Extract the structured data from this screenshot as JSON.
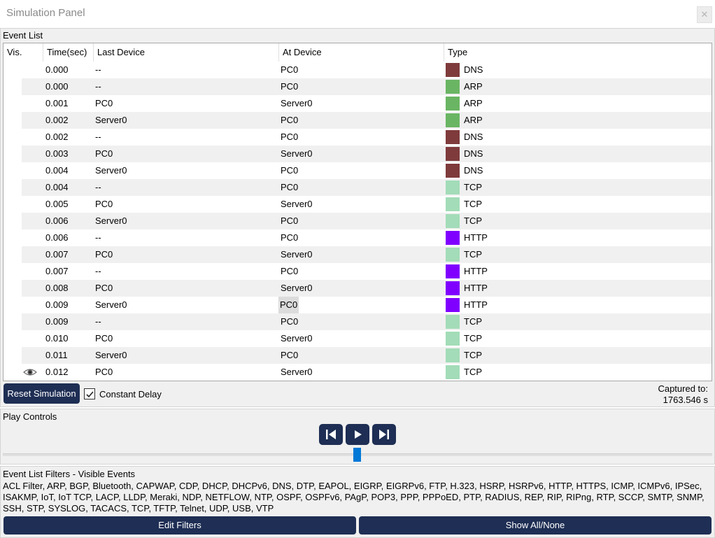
{
  "window": {
    "title": "Simulation Panel",
    "close_glyph": "✕"
  },
  "event_list": {
    "label": "Event List",
    "columns": {
      "vis": "Vis.",
      "time": "Time(sec)",
      "last_device": "Last Device",
      "at_device": "At Device",
      "type": "Type"
    },
    "type_colors": {
      "DNS": "#7f3b3b",
      "ARP": "#6ab563",
      "TCP": "#a3dcb8",
      "HTTP": "#8000ff"
    },
    "rows": [
      {
        "time": "0.000",
        "last": "--",
        "at": "PC0",
        "type": "DNS"
      },
      {
        "time": "0.000",
        "last": "--",
        "at": "PC0",
        "type": "ARP"
      },
      {
        "time": "0.001",
        "last": "PC0",
        "at": "Server0",
        "type": "ARP"
      },
      {
        "time": "0.002",
        "last": "Server0",
        "at": "PC0",
        "type": "ARP"
      },
      {
        "time": "0.002",
        "last": "--",
        "at": "PC0",
        "type": "DNS"
      },
      {
        "time": "0.003",
        "last": "PC0",
        "at": "Server0",
        "type": "DNS"
      },
      {
        "time": "0.004",
        "last": "Server0",
        "at": "PC0",
        "type": "DNS"
      },
      {
        "time": "0.004",
        "last": "--",
        "at": "PC0",
        "type": "TCP"
      },
      {
        "time": "0.005",
        "last": "PC0",
        "at": "Server0",
        "type": "TCP"
      },
      {
        "time": "0.006",
        "last": "Server0",
        "at": "PC0",
        "type": "TCP"
      },
      {
        "time": "0.006",
        "last": "--",
        "at": "PC0",
        "type": "HTTP"
      },
      {
        "time": "0.007",
        "last": "PC0",
        "at": "Server0",
        "type": "TCP"
      },
      {
        "time": "0.007",
        "last": "--",
        "at": "PC0",
        "type": "HTTP"
      },
      {
        "time": "0.008",
        "last": "PC0",
        "at": "Server0",
        "type": "HTTP"
      },
      {
        "time": "0.009",
        "last": "Server0",
        "at": "PC0",
        "type": "HTTP",
        "selected_at": true
      },
      {
        "time": "0.009",
        "last": "--",
        "at": "PC0",
        "type": "TCP"
      },
      {
        "time": "0.010",
        "last": "PC0",
        "at": "Server0",
        "type": "TCP"
      },
      {
        "time": "0.011",
        "last": "Server0",
        "at": "PC0",
        "type": "TCP"
      },
      {
        "time": "0.012",
        "last": "PC0",
        "at": "Server0",
        "type": "TCP",
        "visible_icon": "eye-icon"
      }
    ]
  },
  "controls": {
    "reset_label": "Reset Simulation",
    "constant_delay_label": "Constant Delay",
    "constant_delay_checked": true,
    "captured_label": "Captured to:",
    "captured_value": "1763.546 s"
  },
  "play_controls": {
    "label": "Play Controls",
    "buttons": [
      "step-back-icon",
      "play-icon",
      "step-forward-icon"
    ],
    "slider_position": 0.5
  },
  "filters": {
    "label": "Event List Filters - Visible Events",
    "list": "ACL Filter, ARP, BGP, Bluetooth, CAPWAP, CDP, DHCP, DHCPv6, DNS, DTP, EAPOL, EIGRP, EIGRPv6, FTP, H.323, HSRP, HSRPv6, HTTP, HTTPS, ICMP, ICMPv6, IPSec, ISAKMP, IoT, IoT TCP, LACP, LLDP, Meraki, NDP, NETFLOW, NTP, OSPF, OSPFv6, PAgP, POP3, PPP, PPPoED, PTP, RADIUS, REP, RIP, RIPng, RTP, SCCP, SMTP, SNMP, SSH, STP, SYSLOG, TACACS, TCP, TFTP, Telnet, UDP, USB, VTP",
    "edit_label": "Edit Filters",
    "show_label": "Show All/None"
  },
  "colors": {
    "button_bg": "#1e2e54",
    "slider": "#0078d7"
  }
}
